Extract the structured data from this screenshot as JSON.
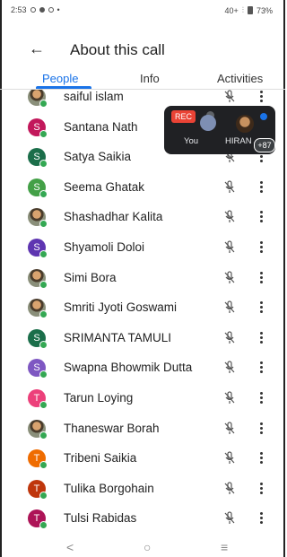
{
  "status_bar": {
    "time": "2:53",
    "right_text": "40+ ",
    "battery": "73%"
  },
  "header": {
    "title": "About this call"
  },
  "tabs": [
    {
      "label": "People",
      "active": true
    },
    {
      "label": "Info",
      "active": false
    },
    {
      "label": "Activities",
      "active": false
    }
  ],
  "overlay": {
    "rec_label": "REC",
    "you_label": "You",
    "other_label": "HIRAN",
    "more_count": "+87"
  },
  "participants": [
    {
      "name": "saiful islam",
      "initial": "",
      "color": "#8a8f7a",
      "photo": true
    },
    {
      "name": "Santana Nath",
      "initial": "S",
      "color": "#c2185b",
      "photo": false
    },
    {
      "name": "Satya Saikia",
      "initial": "S",
      "color": "#1b6e4a",
      "photo": false
    },
    {
      "name": "Seema Ghatak",
      "initial": "S",
      "color": "#43a047",
      "photo": false
    },
    {
      "name": "Shashadhar Kalita",
      "initial": "",
      "color": "#3e5f8a",
      "photo": true
    },
    {
      "name": "Shyamoli Doloi",
      "initial": "S",
      "color": "#5e35b1",
      "photo": false
    },
    {
      "name": "Simi Bora",
      "initial": "",
      "color": "#8a6b5a",
      "photo": true
    },
    {
      "name": "Smriti Jyoti Goswami",
      "initial": "",
      "color": "#5a5a5a",
      "photo": true
    },
    {
      "name": "SRIMANTA TAMULI",
      "initial": "S",
      "color": "#1b6e4a",
      "photo": false
    },
    {
      "name": "Swapna Bhowmik Dutta",
      "initial": "S",
      "color": "#7e57c2",
      "photo": false
    },
    {
      "name": "Tarun Loying",
      "initial": "T",
      "color": "#ec407a",
      "photo": false
    },
    {
      "name": "Thaneswar Borah",
      "initial": "",
      "color": "#6b7a88",
      "photo": true
    },
    {
      "name": "Tribeni Saikia",
      "initial": "T",
      "color": "#ef6c00",
      "photo": false
    },
    {
      "name": "Tulika Borgohain",
      "initial": "T",
      "color": "#bf360c",
      "photo": false
    },
    {
      "name": "Tulsi Rabidas",
      "initial": "T",
      "color": "#ad1457",
      "photo": false
    }
  ],
  "icons": {
    "back": "arrow-left-icon",
    "mic": "mic-off-icon",
    "menu": "more-vert-icon",
    "nav_back": "nav-back-icon",
    "nav_home": "nav-home-icon",
    "nav_recents": "nav-recents-icon"
  },
  "nav_bar": {
    "back": "<",
    "home": "○",
    "recents": "≡"
  }
}
